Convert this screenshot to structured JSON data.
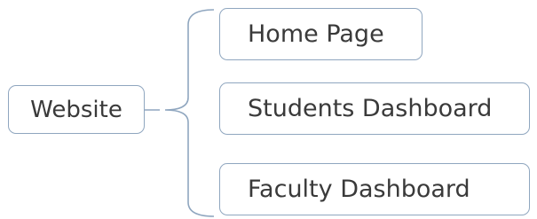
{
  "diagram": {
    "root": {
      "label": "Website"
    },
    "children": [
      {
        "label": "Home Page"
      },
      {
        "label": "Students Dashboard"
      },
      {
        "label": "Faculty Dashboard"
      }
    ]
  },
  "colors": {
    "border": "#8fa6bf",
    "connector": "#8fa6bf",
    "text": "#3a3a3a",
    "background": "#ffffff"
  }
}
